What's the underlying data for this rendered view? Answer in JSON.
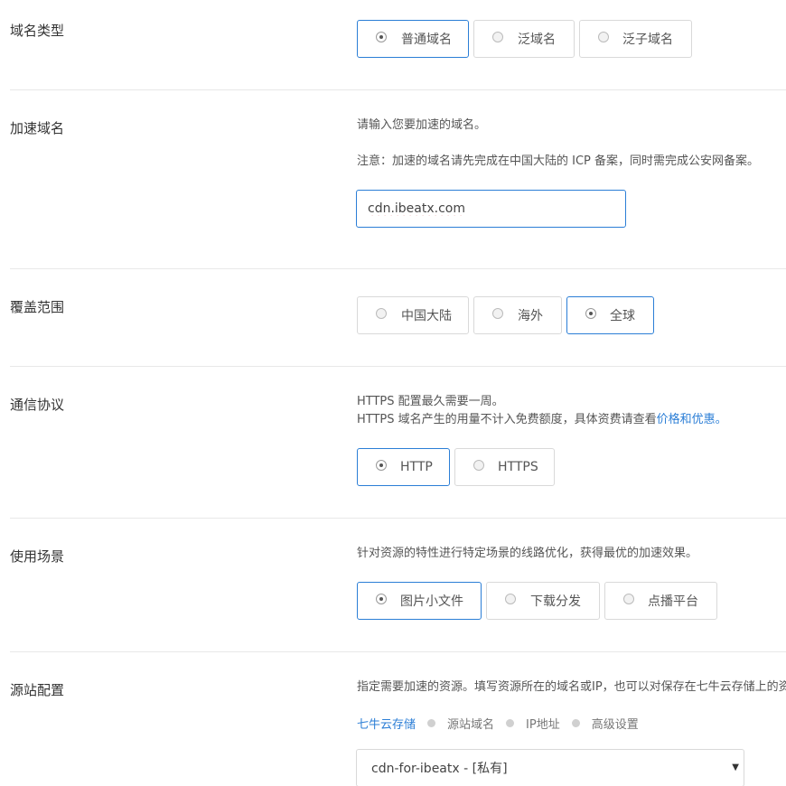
{
  "domain_type": {
    "label": "域名类型",
    "options": [
      "普通域名",
      "泛域名",
      "泛子域名"
    ],
    "selected": "普通域名"
  },
  "accel_domain": {
    "label": "加速域名",
    "hint": "请输入您要加速的域名。",
    "notice": "注意：加速的域名请先完成在中国大陆的 ICP 备案，同时需完成公安网备案。",
    "value": "cdn.ibeatx.com"
  },
  "coverage": {
    "label": "覆盖范围",
    "options": [
      "中国大陆",
      "海外",
      "全球"
    ],
    "selected": "全球"
  },
  "protocol": {
    "label": "通信协议",
    "desc_line1": "HTTPS 配置最久需要一周。",
    "desc_line2_prefix": "HTTPS 域名产生的用量不计入免费额度，具体资费请查看",
    "desc_line2_link": "价格和优惠",
    "desc_line2_suffix": "。",
    "options": [
      "HTTP",
      "HTTPS"
    ],
    "selected": "HTTP"
  },
  "scenario": {
    "label": "使用场景",
    "desc": "针对资源的特性进行特定场景的线路优化，获得最优的加速效果。",
    "options": [
      "图片小文件",
      "下载分发",
      "点播平台"
    ],
    "selected": "图片小文件"
  },
  "origin": {
    "label": "源站配置",
    "desc": "指定需要加速的资源。填写资源所在的域名或IP，也可以对保存在七牛云存储上的资源进行加速。",
    "tabs": [
      "七牛云存储",
      "源站域名",
      "IP地址",
      "高级设置"
    ],
    "active_tab": "七牛云存储",
    "select_value": "cdn-for-ibeatx - [私有]",
    "arrow_icon": "caret-down-icon"
  },
  "colors": {
    "accent": "#2b7ed6",
    "border": "#d9d9d9",
    "divider": "#e8e8e8"
  }
}
